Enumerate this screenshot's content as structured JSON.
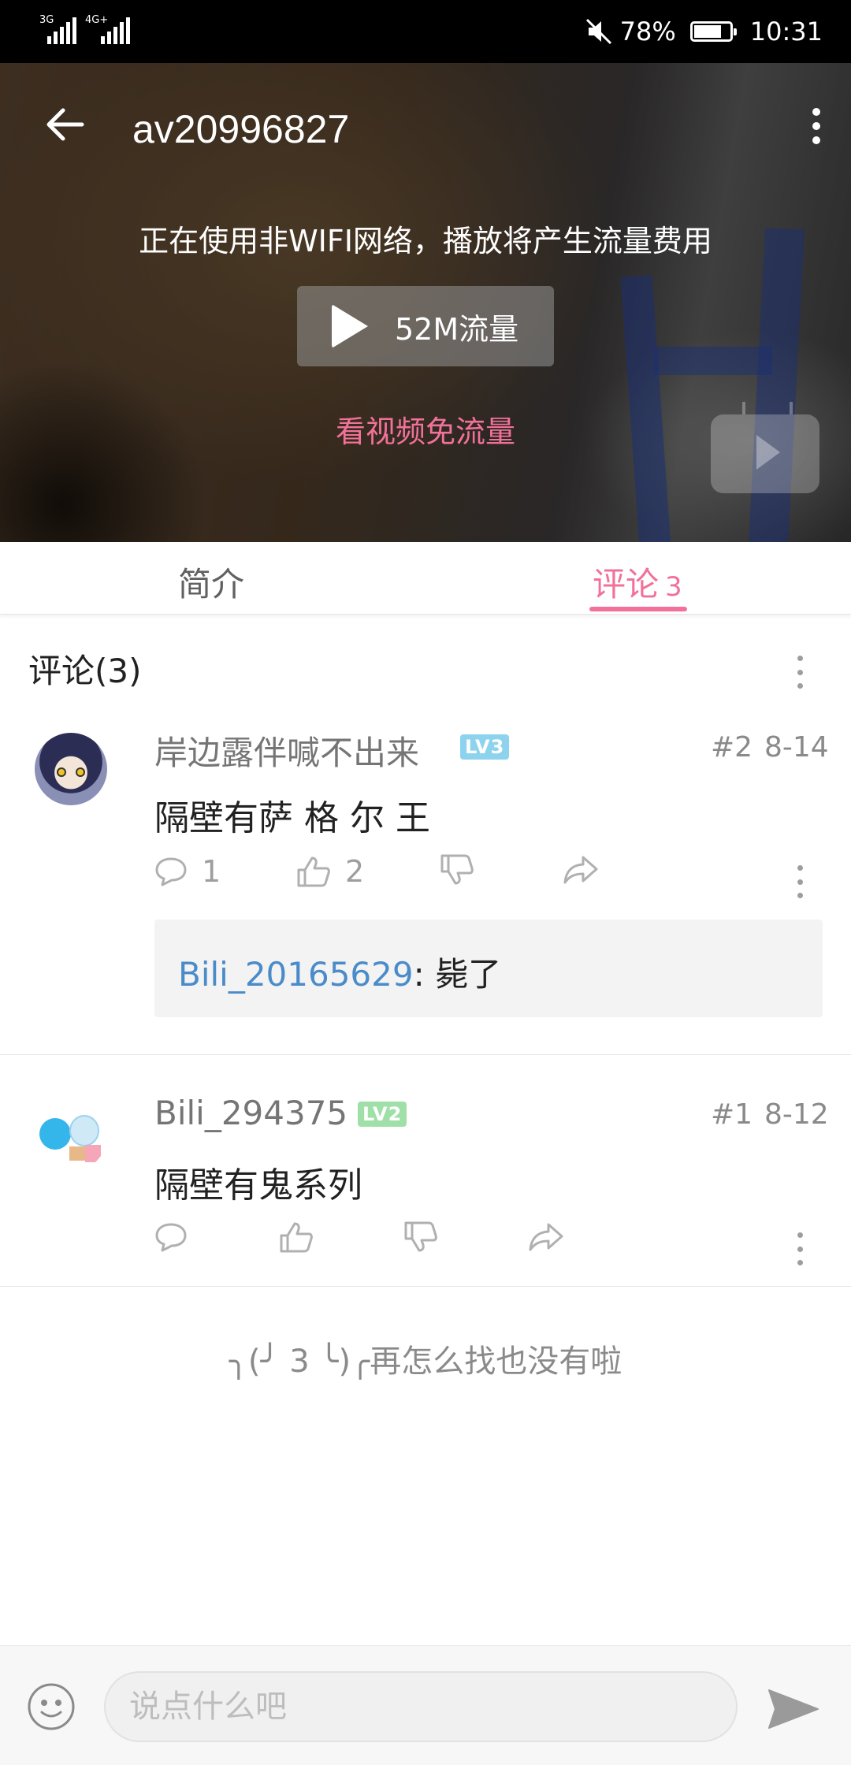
{
  "status_bar": {
    "net1": "3G",
    "net2": "4G+",
    "battery_percent": "78%",
    "battery_level": 0.78,
    "time": "10:31"
  },
  "video": {
    "title": "av20996827",
    "warning": "正在使用非WIFI网络，播放将产生流量费用",
    "play_label": "52M流量",
    "free_link": "看视频免流量"
  },
  "tabs": {
    "intro": "简介",
    "comments": "评论",
    "comments_count": "3"
  },
  "comments": {
    "header": "评论(3)",
    "items": [
      {
        "username": "岸边露伴喊不出来",
        "level": "LV3",
        "floor": "#2",
        "date": "8-14",
        "text": "隔壁有萨 格 尔 王",
        "reply_count": "1",
        "like_count": "2",
        "reply": {
          "user": "Bili_20165629",
          "sep": ": ",
          "text": "毙了"
        }
      },
      {
        "username": "Bili_294375",
        "level": "LV2",
        "floor": "#1",
        "date": "8-12",
        "text": "隔壁有鬼系列"
      }
    ],
    "end_text": "╮(╯ 3 ╰)╭再怎么找也没有啦"
  },
  "bottom": {
    "input_placeholder": "说点什么吧"
  },
  "colors": {
    "accent": "#f2719a",
    "link": "#4a8bc9",
    "lv3": "#8ed3ee",
    "lv2": "#9fe0a8"
  }
}
